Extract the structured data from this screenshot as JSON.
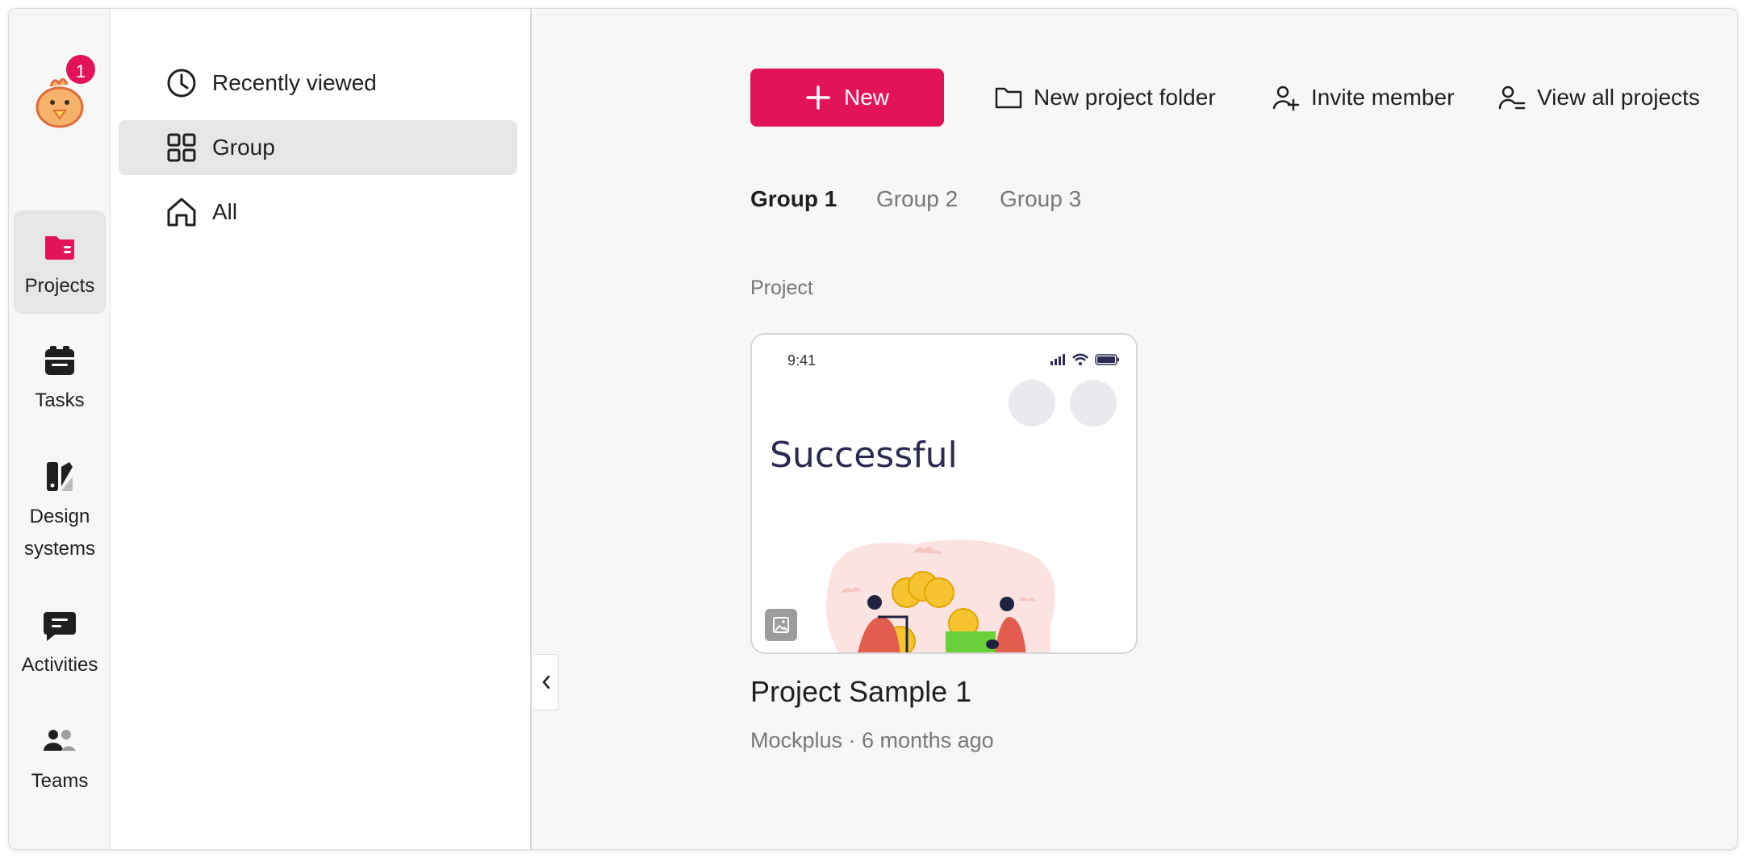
{
  "user": {
    "notification_count": "1"
  },
  "rail": {
    "items": [
      {
        "label": "Projects"
      },
      {
        "label": "Tasks"
      },
      {
        "label": "Design\nsystems"
      },
      {
        "label": "Activities"
      },
      {
        "label": "Teams"
      }
    ]
  },
  "nav": {
    "items": [
      {
        "label": "Recently viewed"
      },
      {
        "label": "Group"
      },
      {
        "label": "All"
      }
    ]
  },
  "toolbar": {
    "new_label": "New",
    "new_folder_label": "New project folder",
    "invite_label": "Invite member",
    "view_all_label": "View all projects"
  },
  "tabs": [
    {
      "label": "Group 1"
    },
    {
      "label": "Group 2"
    },
    {
      "label": "Group 3"
    }
  ],
  "section": {
    "label": "Project"
  },
  "project": {
    "preview_time": "9:41",
    "preview_title": "Successful",
    "name": "Project Sample 1",
    "meta": "Mockplus · 6 months ago"
  },
  "colors": {
    "accent": "#e3135a",
    "active_bg": "#e6e6e6"
  },
  "icons": {
    "avatar": "chick-avatar-icon",
    "projects": "folder-icon",
    "tasks": "task-box-icon",
    "design_systems": "swatch-icon",
    "activities": "chat-bubble-icon",
    "teams": "people-icon",
    "recent": "clock-icon",
    "group": "grid-icon",
    "all": "home-icon",
    "collapse": "chevron-left-icon"
  }
}
